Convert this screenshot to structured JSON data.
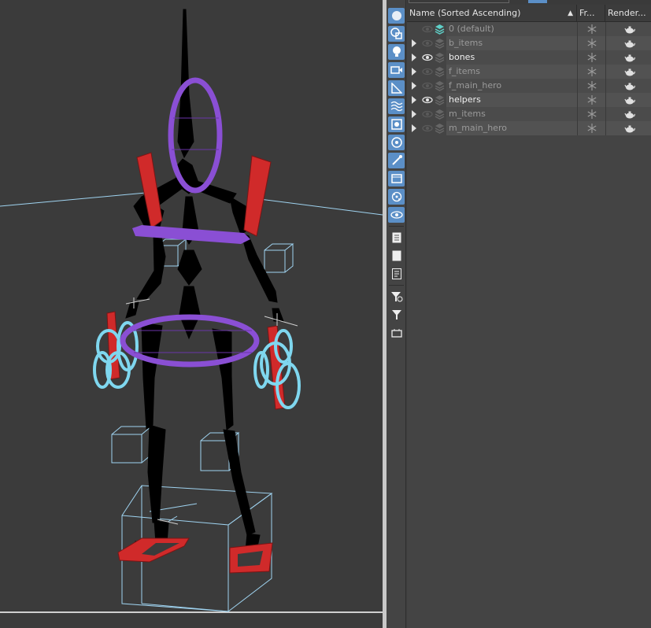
{
  "colors": {
    "viewport_bg": "#3b3b3b",
    "bone": "#000000",
    "purple_control": "#8a4fd4",
    "red_control": "#d02a2a",
    "cyan_control": "#7fd7ef",
    "wire_helper": "#9fd3f0",
    "accent": "#5b8fc7"
  },
  "toolbar": {
    "buttons": [
      {
        "icon": "display-all-icon",
        "active": true
      },
      {
        "icon": "geometry-icon",
        "active": true
      },
      {
        "icon": "light-bulb-icon",
        "active": true
      },
      {
        "icon": "camera-icon",
        "active": true
      },
      {
        "icon": "helper-ruler-icon",
        "active": true
      },
      {
        "icon": "space-warp-icon",
        "active": true
      },
      {
        "icon": "group-icon",
        "active": true
      },
      {
        "icon": "xref-icon",
        "active": true
      },
      {
        "icon": "bone-icon",
        "active": true
      },
      {
        "icon": "container-icon",
        "active": true
      },
      {
        "icon": "particle-icon",
        "active": true
      },
      {
        "icon": "visibility-icon",
        "active": true
      },
      {
        "icon": "select-list-icon",
        "active": false
      },
      {
        "icon": "select-none-icon",
        "active": false
      },
      {
        "icon": "invert-select-icon",
        "active": false
      },
      {
        "icon": "filter-settings-icon",
        "active": false
      },
      {
        "icon": "filter-icon",
        "active": false
      },
      {
        "icon": "layer-filter-icon",
        "active": false
      }
    ]
  },
  "explorer": {
    "columns": {
      "name": "Name (Sorted Ascending)",
      "sort_indicator": "▲",
      "frozen": "Fr...",
      "render": "Render..."
    },
    "rows": [
      {
        "name": "0 (default)",
        "visible": false,
        "expandable": false,
        "active_layer": true
      },
      {
        "name": "b_items",
        "visible": false,
        "expandable": true,
        "active_layer": false
      },
      {
        "name": "bones",
        "visible": true,
        "expandable": true,
        "active_layer": false
      },
      {
        "name": "f_items",
        "visible": false,
        "expandable": true,
        "active_layer": false
      },
      {
        "name": "f_main_hero",
        "visible": false,
        "expandable": true,
        "active_layer": false
      },
      {
        "name": "helpers",
        "visible": true,
        "expandable": true,
        "active_layer": false
      },
      {
        "name": "m_items",
        "visible": false,
        "expandable": true,
        "active_layer": false
      },
      {
        "name": "m_main_hero",
        "visible": false,
        "expandable": true,
        "active_layer": false
      }
    ]
  }
}
